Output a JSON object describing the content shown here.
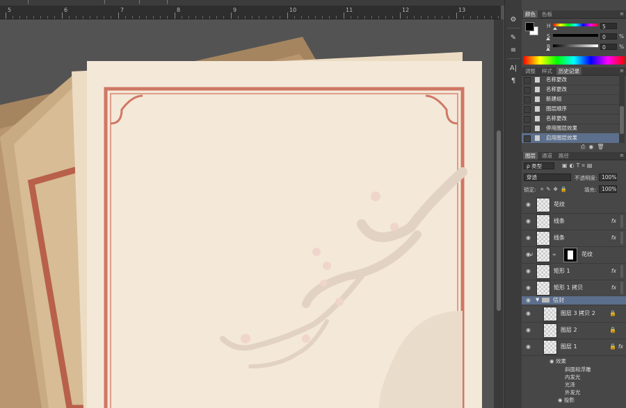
{
  "ruler": {
    "numbers": [
      "5",
      "6",
      "7",
      "8",
      "9",
      "10",
      "11",
      "12",
      "13"
    ]
  },
  "dock": {
    "icons": [
      "history-panel-icon",
      "brush-tool-icon",
      "brush-preset-icon",
      "character-icon",
      "paragraph-icon"
    ],
    "glyphs": [
      "⚙",
      "✎",
      "≡",
      "A|",
      "¶"
    ]
  },
  "color_panel": {
    "tabs": [
      "颜色",
      "色板"
    ],
    "sliders": [
      {
        "label": "H",
        "value": "5",
        "unit": ""
      },
      {
        "label": "S",
        "value": "0",
        "unit": "%"
      },
      {
        "label": "B",
        "value": "0",
        "unit": "%"
      }
    ],
    "foreground": "#000000",
    "background": "#ffffff"
  },
  "history_panel": {
    "tabs": [
      "调整",
      "样式",
      "历史记录"
    ],
    "items": [
      "名称更改",
      "名称更改",
      "新建组",
      "图层顺序",
      "名称更改",
      "停用图层效果",
      "启用图层效果"
    ],
    "selected_index": 6
  },
  "layers_panel": {
    "tabs": [
      "图层",
      "通道",
      "路径"
    ],
    "filter_label": "ρ 类型",
    "blend_mode": "穿透",
    "opacity_label": "不透明度:",
    "opacity_value": "100%",
    "lock_label": "锁定:",
    "fill_label": "填充:",
    "fill_value": "100%",
    "layers": [
      {
        "name": "花纹",
        "fx": ""
      },
      {
        "name": "线条",
        "fx": "fx"
      },
      {
        "name": "线条",
        "fx": "fx"
      },
      {
        "name": "花纹",
        "fx": ""
      },
      {
        "name": "矩形 1",
        "fx": "fx"
      },
      {
        "name": "矩形 1 拷贝",
        "fx": "fx"
      }
    ],
    "group_name": "信封",
    "group_layers": [
      {
        "name": "图层 3 拷贝 2",
        "lock": "🔒",
        "fx": ""
      },
      {
        "name": "图层 2",
        "lock": "🔒",
        "fx": ""
      },
      {
        "name": "图层 1",
        "lock": "🔒",
        "fx": "fx"
      }
    ],
    "effects_label": "效果",
    "effects": [
      "斜面和浮雕",
      "内发光",
      "光泽",
      "外发光",
      "投影"
    ]
  }
}
